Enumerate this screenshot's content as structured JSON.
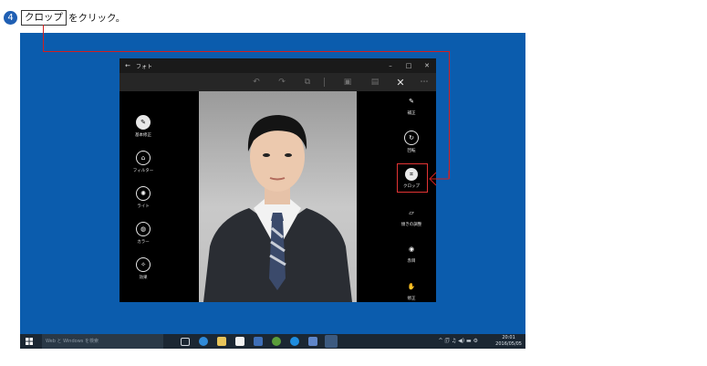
{
  "instruction": {
    "step_number": "4",
    "key_label": "クロップ",
    "rest": "をクリック。"
  },
  "window": {
    "title": "フォト",
    "back_glyph": "←",
    "min_glyph": "–",
    "max_glyph": "□",
    "close_glyph": "✕"
  },
  "toolbar": {
    "undo": "↶",
    "redo": "↷",
    "compare": "⧉",
    "save_copy": "▣",
    "save": "▤",
    "close": "✕",
    "more": "⋯"
  },
  "left_tools": [
    {
      "label": "基本修正",
      "icon": "wand-icon",
      "glyph": "✎",
      "active": true
    },
    {
      "label": "フィルター",
      "icon": "filter-icon",
      "glyph": "⌂",
      "active": false
    },
    {
      "label": "ライト",
      "icon": "sun-icon",
      "glyph": "✺",
      "active": false
    },
    {
      "label": "カラー",
      "icon": "palette-icon",
      "glyph": "◍",
      "active": false
    },
    {
      "label": "効果",
      "icon": "effects-icon",
      "glyph": "✧",
      "active": false
    }
  ],
  "right_tools": [
    {
      "label": "補正",
      "icon": "enhance-wand-icon",
      "glyph": "✎"
    },
    {
      "label": "回転",
      "icon": "rotate-icon",
      "glyph": "↻"
    },
    {
      "label": "クロップ",
      "icon": "crop-icon",
      "glyph": "⌗",
      "highlight": true
    },
    {
      "label": "傾きの調整",
      "icon": "straighten-icon",
      "glyph": "▱"
    },
    {
      "label": "赤目",
      "icon": "red-eye-icon",
      "glyph": "◉"
    },
    {
      "label": "修正",
      "icon": "retouch-icon",
      "glyph": "✋"
    }
  ],
  "taskbar": {
    "search_placeholder": "Web と Windows を検索",
    "time": "20:01",
    "date": "2016/05/05",
    "tray_glyphs": "^ 🗊 ♫ ◀) ▬ ⚙",
    "colors": {
      "bar": "#1b2733",
      "desktop": "#0b5cad",
      "accent_red": "#d21f1f"
    }
  }
}
